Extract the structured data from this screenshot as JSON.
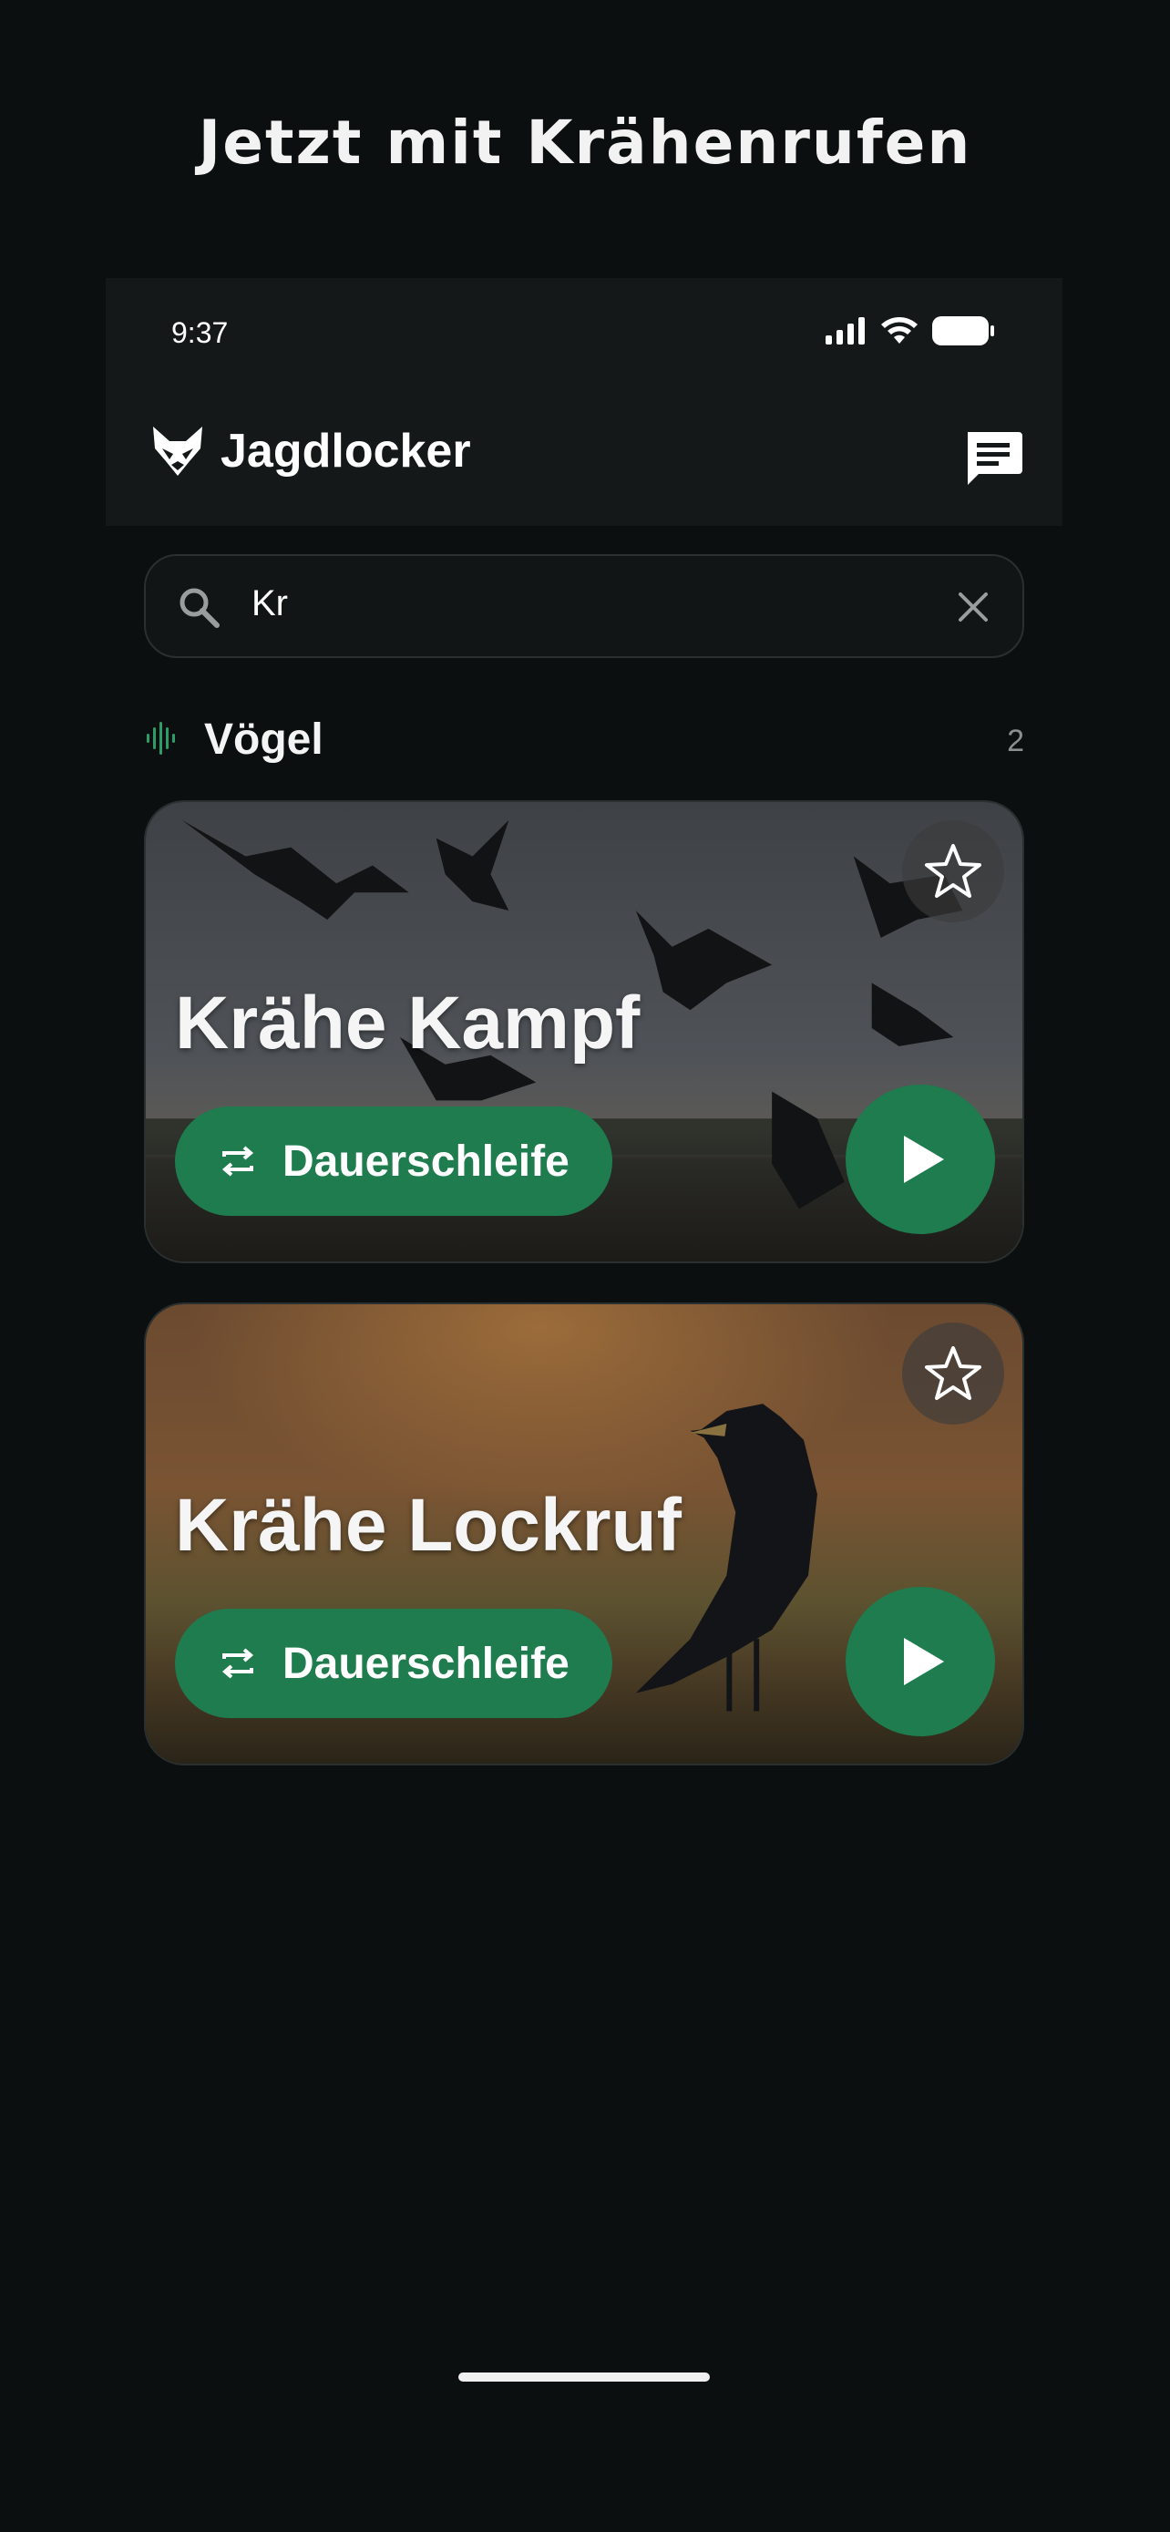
{
  "promo": {
    "headline": "Jetzt mit Krähenrufen"
  },
  "status_bar": {
    "time": "9:37",
    "icons": [
      "cellular-signal-icon",
      "wifi-icon",
      "battery-icon"
    ]
  },
  "header": {
    "app_name": "Jagdlocker",
    "logo_icon": "fox-head-icon",
    "action_icon": "chat-bubble-icon"
  },
  "search": {
    "value": "Kr",
    "clear_icon": "close-icon",
    "search_icon": "search-icon"
  },
  "section": {
    "icon": "sound-wave-icon",
    "title": "Vögel",
    "count": "2"
  },
  "cards": [
    {
      "title": "Krähe Kampf",
      "loop_label": "Dauerschleife",
      "favorite": false
    },
    {
      "title": "Krähe Lockruf",
      "loop_label": "Dauerschleife",
      "favorite": false
    }
  ],
  "colors": {
    "background": "#0b0f0f",
    "accent_green": "#1e7c4e",
    "section_icon": "#2e9c66"
  }
}
